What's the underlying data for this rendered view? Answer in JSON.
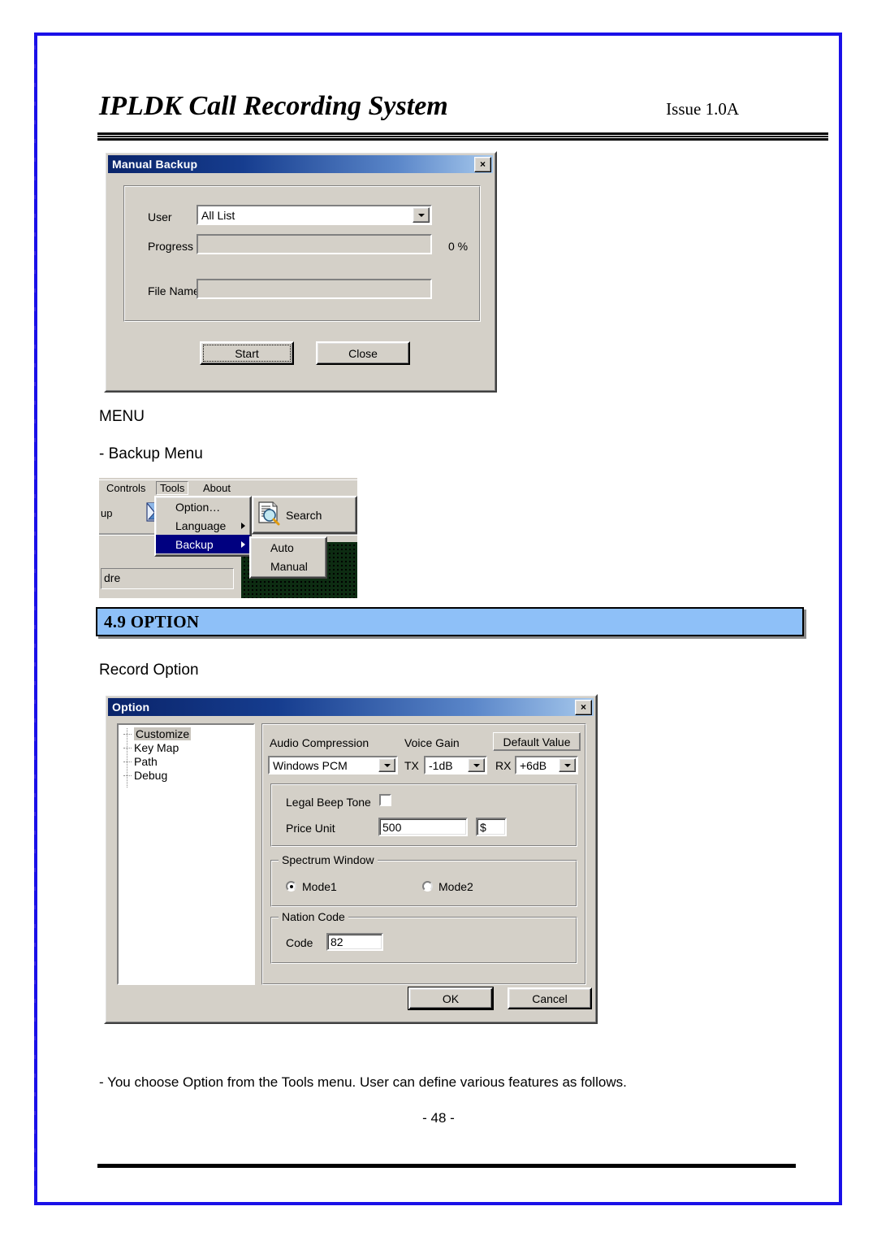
{
  "document": {
    "title": "IPLDK Call Recording System",
    "issue": "Issue 1.0A",
    "page_number": "- 48 -"
  },
  "manual_backup_dialog": {
    "title": "Manual Backup",
    "close_glyph": "×",
    "user_label": "User",
    "user_value": "All List",
    "progress_label": "Progress",
    "progress_percent": "0 %",
    "progress_value": 0,
    "file_name_label": "File Name",
    "file_name_value": "",
    "start_button": "Start",
    "close_button": "Close"
  },
  "menu_section": {
    "heading": "MENU",
    "subheading": "- Backup Menu"
  },
  "menu_screenshot": {
    "menubar": [
      "Controls",
      "Tools",
      "About"
    ],
    "open_menu": "Tools",
    "toolbar_partial_label": "up",
    "tools_menu_items": [
      {
        "label": "Option…",
        "has_submenu": false,
        "selected": false
      },
      {
        "label": "Language",
        "has_submenu": true,
        "selected": false
      },
      {
        "label": "Backup",
        "has_submenu": true,
        "selected": true
      }
    ],
    "backup_submenu_items": [
      "Auto",
      "Manual"
    ],
    "search_flyout_label": "Search",
    "name_field_partial_text": "dre"
  },
  "section": {
    "number_title": "4.9 OPTION",
    "subtitle": "Record Option"
  },
  "option_dialog": {
    "title": "Option",
    "close_glyph": "×",
    "tree_items": [
      "Customize",
      "Key Map",
      "Path",
      "Debug"
    ],
    "tree_selected": "Customize",
    "audio_compression_label": "Audio Compression",
    "audio_compression_value": "Windows PCM",
    "voice_gain_label": "Voice Gain",
    "default_value_button": "Default Value",
    "tx_label": "TX",
    "tx_value": "-1dB",
    "rx_label": "RX",
    "rx_value": "+6dB",
    "legal_beep_tone_label": "Legal Beep Tone",
    "legal_beep_tone_checked": false,
    "price_unit_label": "Price Unit",
    "price_unit_value": "500",
    "currency_value": "$",
    "spectrum_window_legend": "Spectrum Window",
    "spectrum_mode1": "Mode1",
    "spectrum_mode2": "Mode2",
    "spectrum_selected": "Mode1",
    "nation_code_legend": "Nation Code",
    "code_label": "Code",
    "code_value": "82",
    "ok_button": "OK",
    "cancel_button": "Cancel"
  },
  "footer_note": "- You choose Option from the Tools menu. User can define various features as follows.",
  "colors": {
    "page_border": "#1a10e8",
    "section_head_bg": "#8ec0f8",
    "dialog_face": "#d4d0c8",
    "titlebar_start": "#0a246a",
    "menu_highlight": "#000080"
  }
}
